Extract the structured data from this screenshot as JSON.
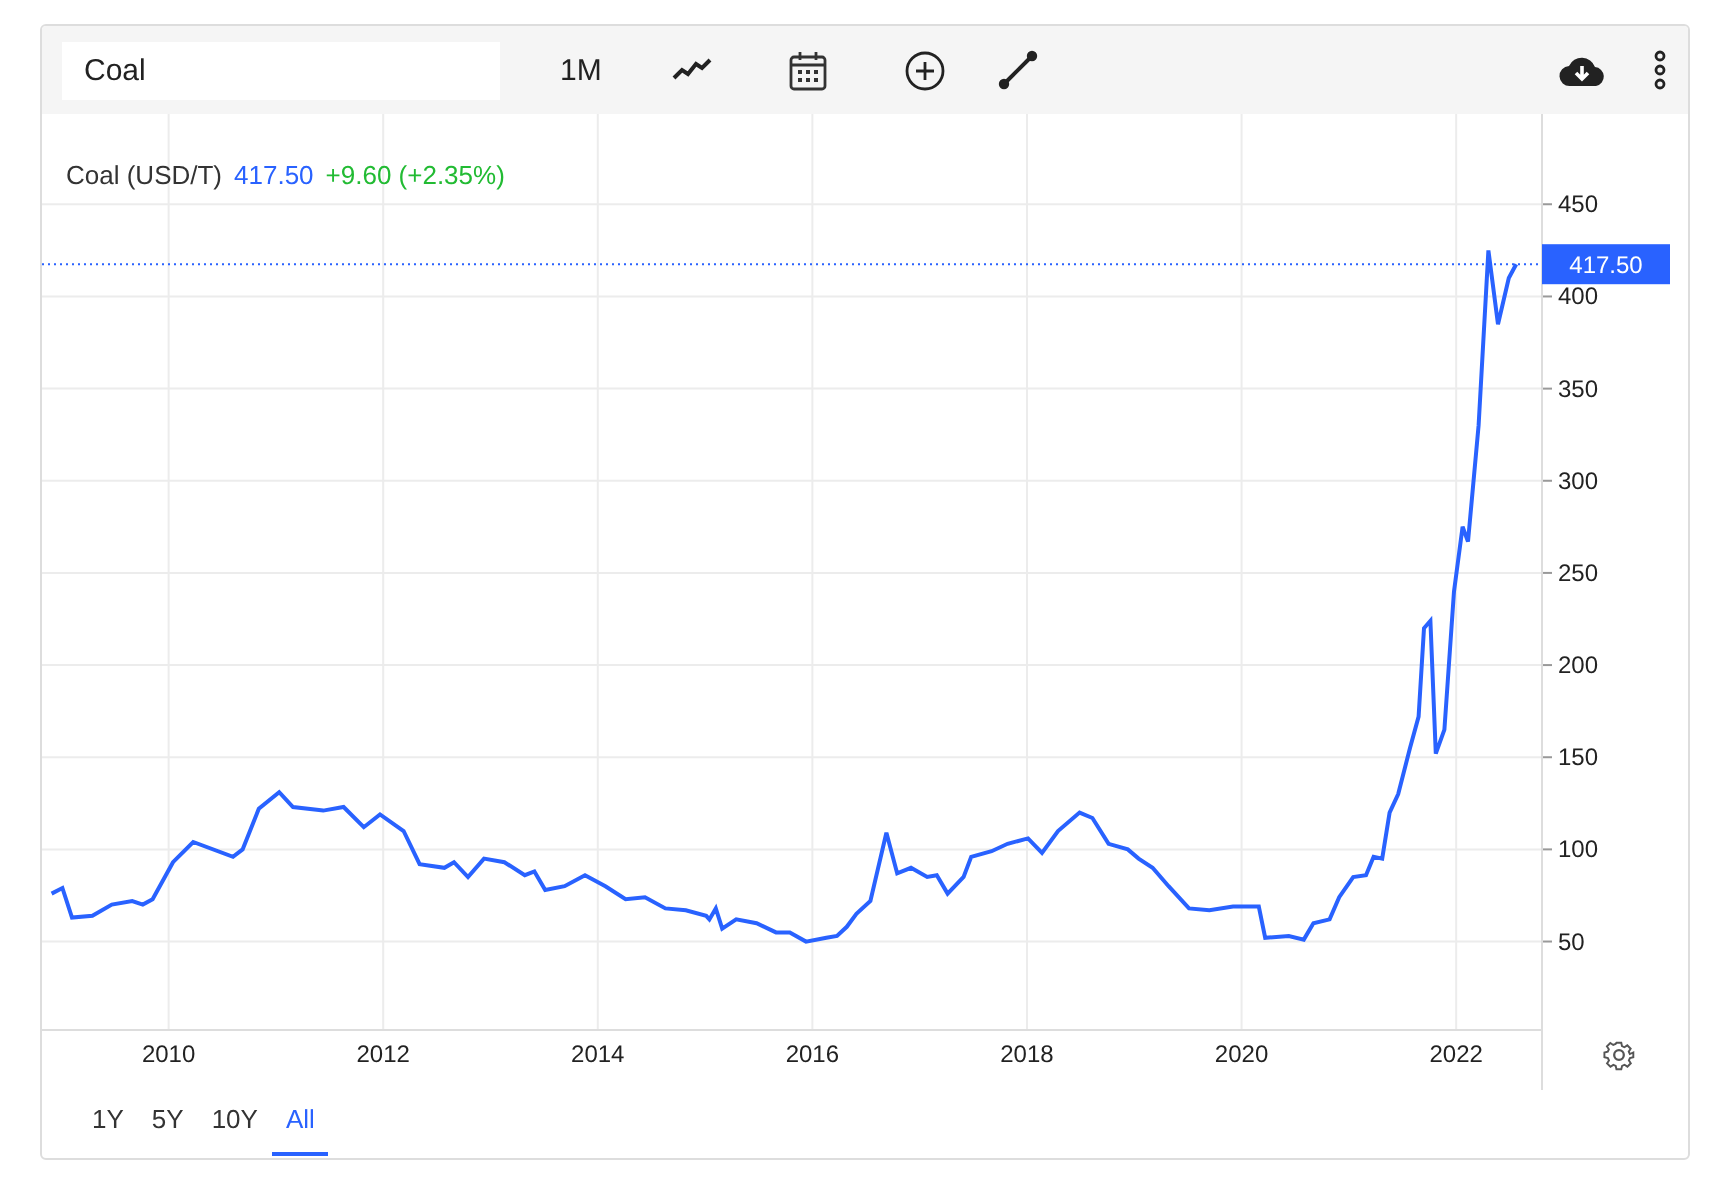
{
  "toolbar": {
    "search": {
      "value": "Coal"
    },
    "interval": "1M"
  },
  "legend": {
    "name": "Coal (USD/T)",
    "price": "417.50",
    "change": "+9.60 (+2.35%)"
  },
  "chart_data": {
    "type": "line",
    "grid": true,
    "xlim": [
      2008.82,
      2022.8
    ],
    "ylim": [
      2,
      499
    ],
    "ref_lines": [
      {
        "axis": "y",
        "value": 417.5,
        "label": "417.50"
      }
    ],
    "xticks": [
      2010,
      2012,
      2014,
      2016,
      2018,
      2020,
      2022
    ],
    "yticks": [
      50,
      100,
      150,
      200,
      250,
      300,
      350,
      400,
      450
    ],
    "x": [
      2008.91,
      2009.01,
      2009.1,
      2009.29,
      2009.47,
      2009.66,
      2009.76,
      2009.85,
      2010.04,
      2010.23,
      2010.6,
      2010.69,
      2010.84,
      2011.03,
      2011.16,
      2011.44,
      2011.63,
      2011.82,
      2011.97,
      2012.19,
      2012.34,
      2012.57,
      2012.66,
      2012.79,
      2012.94,
      2013.13,
      2013.32,
      2013.41,
      2013.51,
      2013.69,
      2013.88,
      2014.07,
      2014.26,
      2014.44,
      2014.63,
      2014.82,
      2015.01,
      2015.04,
      2015.1,
      2015.16,
      2015.29,
      2015.48,
      2015.66,
      2015.79,
      2015.94,
      2016.13,
      2016.23,
      2016.32,
      2016.41,
      2016.54,
      2016.69,
      2016.79,
      2016.92,
      2017.07,
      2017.16,
      2017.26,
      2017.41,
      2017.48,
      2017.67,
      2017.82,
      2018.01,
      2018.14,
      2018.29,
      2018.49,
      2018.61,
      2018.76,
      2018.94,
      2019.04,
      2019.17,
      2019.32,
      2019.51,
      2019.7,
      2019.92,
      2020.16,
      2020.22,
      2020.44,
      2020.58,
      2020.67,
      2020.82,
      2020.91,
      2021.04,
      2021.16,
      2021.23,
      2021.31,
      2021.38,
      2021.46,
      2021.57,
      2021.65,
      2021.7,
      2021.76,
      2021.81,
      2021.89,
      2021.98,
      2022.06,
      2022.11,
      2022.21,
      2022.3,
      2022.39,
      2022.49,
      2022.56
    ],
    "series": [
      {
        "color": "#2962ff",
        "values": [
          76,
          79,
          63,
          64,
          70,
          72,
          70,
          73,
          93,
          104,
          96,
          100,
          122,
          131,
          123,
          121,
          123,
          112,
          119,
          110,
          92,
          90,
          93,
          85,
          95,
          93,
          86,
          88,
          78,
          80,
          86,
          80,
          73,
          74,
          68,
          67,
          64,
          62,
          68,
          57,
          62,
          60,
          55,
          55,
          50,
          52,
          53,
          58,
          65,
          72,
          109,
          87,
          90,
          85,
          86,
          76,
          85,
          96,
          99,
          103,
          106,
          98,
          110,
          120,
          117,
          103,
          100,
          95,
          90,
          80,
          68,
          67,
          69,
          69,
          52,
          53,
          51,
          60,
          62,
          74,
          85,
          86,
          96,
          95,
          120,
          130,
          155,
          172,
          220,
          224,
          152,
          165,
          240,
          275,
          267,
          330,
          425,
          385,
          410,
          417.5
        ]
      }
    ]
  },
  "ranges": [
    {
      "label": "1Y",
      "selected": false
    },
    {
      "label": "5Y",
      "selected": false
    },
    {
      "label": "10Y",
      "selected": false
    },
    {
      "label": "All",
      "selected": true
    }
  ]
}
